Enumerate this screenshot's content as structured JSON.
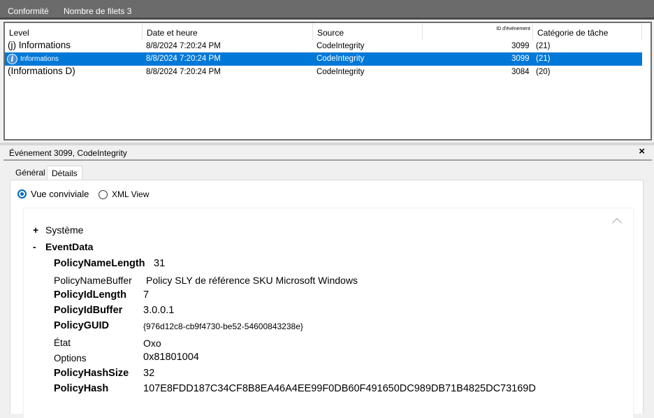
{
  "topbar": {
    "tab_conformite": "Conformité",
    "filter_count": "Nombre de filets 3"
  },
  "grid": {
    "headers": {
      "level": "Level",
      "date": "Date et heure",
      "source": "Source",
      "event_id": "ID d'événement",
      "category": "Catégorie de tâche"
    },
    "rows": [
      {
        "level": "(j) Informations",
        "date": "8/8/2024 7:20:24 PM",
        "source": "CodeIntegrity",
        "event_id": "3099",
        "category": "(21)",
        "selected": false
      },
      {
        "level": "Informations",
        "date": "8/8/2024 7:20:24 PM",
        "source": "CodeIntegrity",
        "event_id": "3099",
        "category": "(21)",
        "selected": true
      },
      {
        "level": "(Informations D)",
        "date": "8/8/2024 7:20:24 PM",
        "source": "CodeIntegrity",
        "event_id": "3084",
        "category": "(20)",
        "selected": false
      }
    ],
    "selection_color": "#0078d7"
  },
  "details": {
    "title": "Événement 3099, CodeIntegrity",
    "close": "×",
    "tabs": [
      "Général",
      "Détails"
    ],
    "active_tab": "Détails",
    "radios": {
      "friendly": "Vue conviviale",
      "xml": "XML View",
      "selected": "friendly"
    },
    "tree": {
      "system_toggle": "+",
      "system_label": "Système",
      "eventdata_toggle": "-",
      "eventdata_label": "EventData"
    },
    "fields": {
      "policy_name_length": {
        "key": "PolicyNameLength",
        "value": "31"
      },
      "policy_name_buffer": {
        "key": "PolicyNameBuffer",
        "value": "Policy SLY de référence SKU Microsoft Windows"
      },
      "policy_id_length": {
        "key": "PolicyIdLength",
        "value": "7"
      },
      "policy_id_buffer": {
        "key": "PolicyIdBuffer",
        "value": "3.0.0.1"
      },
      "policy_guid": {
        "key": "PolicyGUID",
        "value": "{976d12c8-cb9f4730-be52-54600843238e}"
      },
      "etat": {
        "key": "État",
        "value": "Oxo"
      },
      "options": {
        "key": "Options",
        "value": "0x81801004"
      },
      "policy_hash_size": {
        "key": "PolicyHashSize",
        "value": "32"
      },
      "policy_hash": {
        "key": "PolicyHash",
        "value": "107E8FDD187C34CF8B8EA46A4EE99F0DB60F491650DC989DB71B4825DC73169D"
      }
    }
  },
  "icons": {
    "info": "info-icon",
    "close": "close-icon",
    "scroll": "chevron-up-icon"
  },
  "colors": {
    "radio_accent": "#0067c0",
    "topbar": "#6b6b6b"
  }
}
